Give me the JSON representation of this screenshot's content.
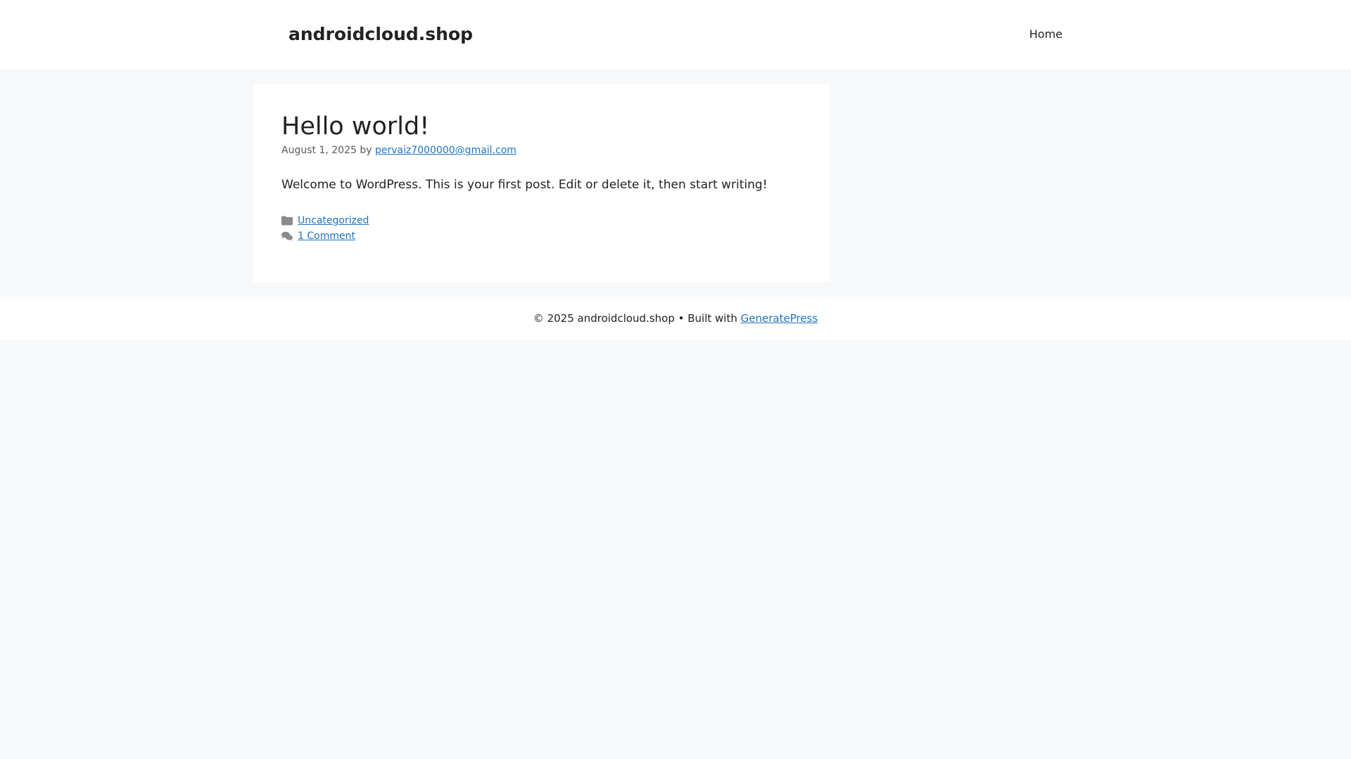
{
  "header": {
    "site_title": "androidcloud.shop",
    "nav": [
      {
        "label": "Home"
      }
    ]
  },
  "post": {
    "title": "Hello world!",
    "date": "August 1, 2025",
    "by_label": "by",
    "author": "pervaiz7000000@gmail.com",
    "content": "Welcome to WordPress. This is your first post. Edit or delete it, then start writing!",
    "category": "Uncategorized",
    "comments": "1 Comment"
  },
  "footer": {
    "copyright": "© 2025 androidcloud.shop • Built with",
    "theme_link": "GeneratePress"
  },
  "colors": {
    "link": "#1e73be",
    "background": "#f7f8f9",
    "text": "#222222",
    "meta": "#595959"
  },
  "icons": {
    "category": "folder-icon",
    "comments": "comments-icon"
  }
}
